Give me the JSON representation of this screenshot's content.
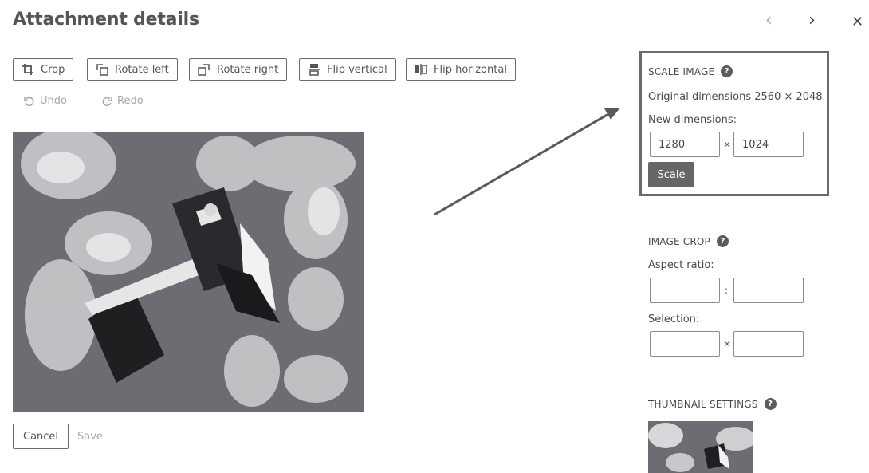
{
  "header": {
    "title": "Attachment details",
    "prev_glyph": "‹",
    "next_glyph": "›",
    "close_glyph": "✕"
  },
  "toolbar": {
    "crop_label": "Crop",
    "rotate_left_label": "Rotate left",
    "rotate_right_label": "Rotate right",
    "flip_vertical_label": "Flip vertical",
    "flip_horizontal_label": "Flip horizontal",
    "undo_label": "Undo",
    "redo_label": "Redo"
  },
  "footer": {
    "cancel_label": "Cancel",
    "save_label": "Save"
  },
  "scale_image": {
    "title": "SCALE IMAGE",
    "original_dimensions": "Original dimensions 2560 × 2048",
    "new_dimensions_label": "New dimensions:",
    "width_value": "1280",
    "height_value": "1024",
    "separator": "×",
    "scale_button": "Scale"
  },
  "image_crop": {
    "title": "IMAGE CROP",
    "aspect_ratio_label": "Aspect ratio:",
    "aspect_separator": ":",
    "selection_label": "Selection:",
    "selection_separator": "×"
  },
  "thumbnail": {
    "title": "THUMBNAIL SETTINGS"
  },
  "colors": {
    "highlight_border": "#6b6b6b",
    "scale_button_bg": "#666666",
    "image_bg": "#6e6b72"
  }
}
